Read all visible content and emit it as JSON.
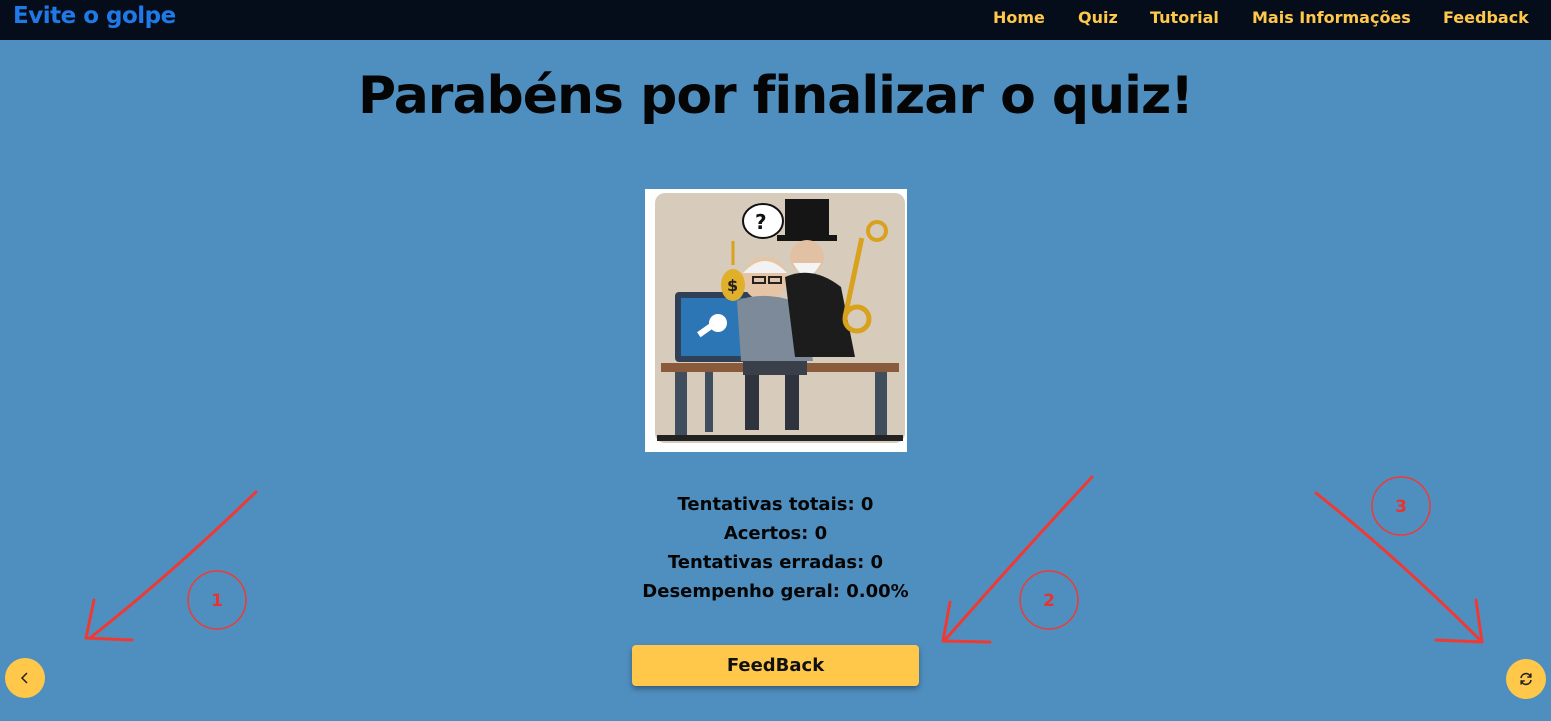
{
  "navbar": {
    "brand": "Evite o golpe",
    "links": [
      "Home",
      "Quiz",
      "Tutorial",
      "Mais Informações",
      "Feedback"
    ]
  },
  "main": {
    "title": "Parabéns por finalizar o quiz!",
    "stats": [
      "Tentativas totais: 0",
      "Acertos: 0",
      "Tentativas erradas: 0",
      "Desempenho geral: 0.00%"
    ],
    "feedback_button": "FeedBack"
  },
  "controls": {
    "back_icon": "chevron-left-icon",
    "restart_icon": "refresh-icon"
  },
  "annotations": [
    "1",
    "2",
    "3"
  ],
  "colors": {
    "background": "#4f8fc0",
    "navbar": "#060d1a",
    "brand": "#1f7ae8",
    "accent": "#ffc84a",
    "annotation": "#e8342e"
  }
}
